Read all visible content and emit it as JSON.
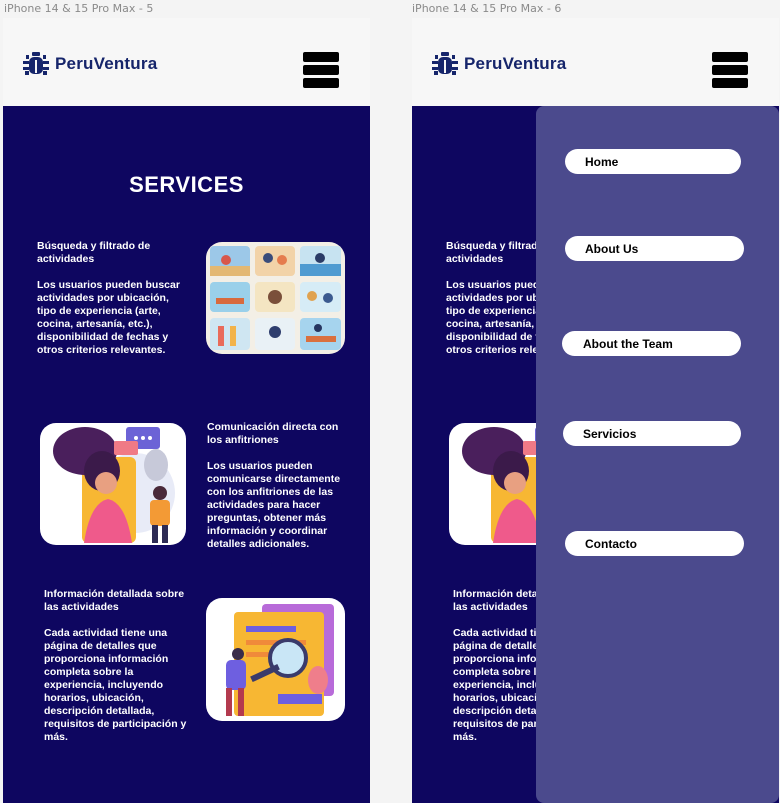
{
  "frames": [
    {
      "label": "iPhone 14 & 15 Pro Max - 5"
    },
    {
      "label": "iPhone 14 & 15 Pro Max - 6"
    }
  ],
  "brand": {
    "name": "PeruVentura",
    "logo_icon": "bug-icon",
    "color": "#16256b"
  },
  "hamburger_icon": "hamburger-menu-icon",
  "page_title": "SERVICES",
  "services": [
    {
      "heading": "Búsqueda y filtrado de actividades",
      "body": "Los usuarios pueden buscar actividades por ubicación, tipo de experiencia (arte, cocina, artesanía, etc.), disponibilidad de fechas y otros criterios relevantes.",
      "image": "activities-grid-illustration"
    },
    {
      "heading": "Comunicación directa con los anfitriones",
      "body": "Los usuarios pueden comunicarse directamente con los anfitriones de las actividades para hacer preguntas, obtener más información y coordinar detalles adicionales.",
      "image": "video-chat-illustration"
    },
    {
      "heading": "Información detallada sobre las actividades",
      "body": "Cada actividad tiene una página de detalles que proporciona información completa sobre la experiencia, incluyendo horarios, ubicación, descripción detallada, requisitos de participación y más.",
      "image": "magnifier-document-illustration"
    }
  ],
  "menu": {
    "items": [
      {
        "label": "Home"
      },
      {
        "label": "About Us"
      },
      {
        "label": "About the Team"
      },
      {
        "label": "Servicios"
      },
      {
        "label": "Contacto"
      }
    ]
  },
  "colors": {
    "background": "#0e0660",
    "menu_panel": "#4b4a8d",
    "header": "#f7f7f7"
  }
}
